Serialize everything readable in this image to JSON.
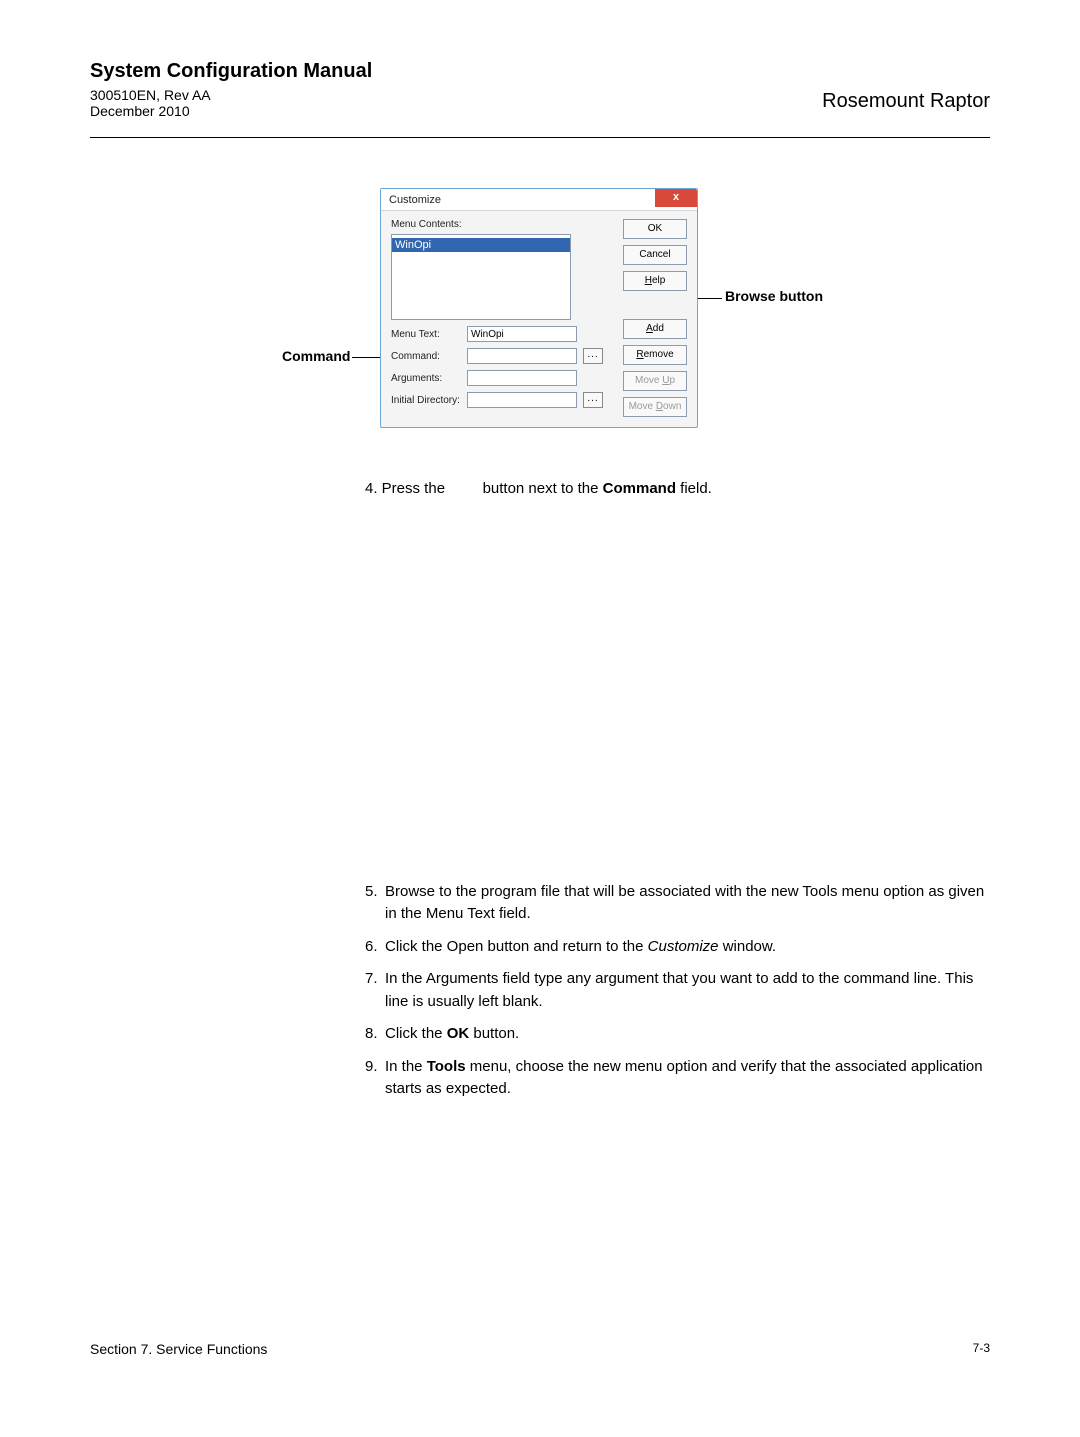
{
  "header": {
    "title": "System Configuration Manual",
    "docid": "300510EN, Rev AA",
    "date": "December 2010",
    "product": "Rosemount Raptor"
  },
  "dialog": {
    "title": "Customize",
    "close_glyph": "x",
    "menu_contents_label": "Menu Contents:",
    "list_item": "WinOpi",
    "menu_text_label": "Menu Text:",
    "menu_text_value": "WinOpi",
    "command_label": "Command:",
    "arguments_label": "Arguments:",
    "initial_dir_label": "Initial Directory:",
    "browse_glyph": "...",
    "buttons": {
      "ok": "OK",
      "cancel": "Cancel",
      "help": "Help",
      "add": "Add",
      "remove": "Remove",
      "moveup": "Move Up",
      "movedown": "Move Down"
    }
  },
  "callouts": {
    "command": "Command",
    "browse": "Browse button"
  },
  "steps": {
    "s4_pre": "4.  Press the",
    "s4_post": "button next to the ",
    "s4_bold": "Command",
    "s4_end": " field.",
    "s5n": "5.",
    "s5": "Browse to the program file that will be associated with the new Tools menu option as given in the Menu Text field.",
    "s6n": "6.",
    "s6a": "Click the Open button and return to the ",
    "s6b": "Customize",
    "s6c": " window.",
    "s7n": "7.",
    "s7": "In the Arguments field type any argument that you want to add to the command line. This line is usually left blank.",
    "s8n": "8.",
    "s8a": "Click the ",
    "s8b": "OK",
    "s8c": " button.",
    "s9n": "9.",
    "s9a": "In the ",
    "s9b": "Tools",
    "s9c": " menu, choose the new menu option and verify that the associated application starts as expected."
  },
  "footer": {
    "section": "Section 7. Service Functions",
    "page": "7-3"
  }
}
